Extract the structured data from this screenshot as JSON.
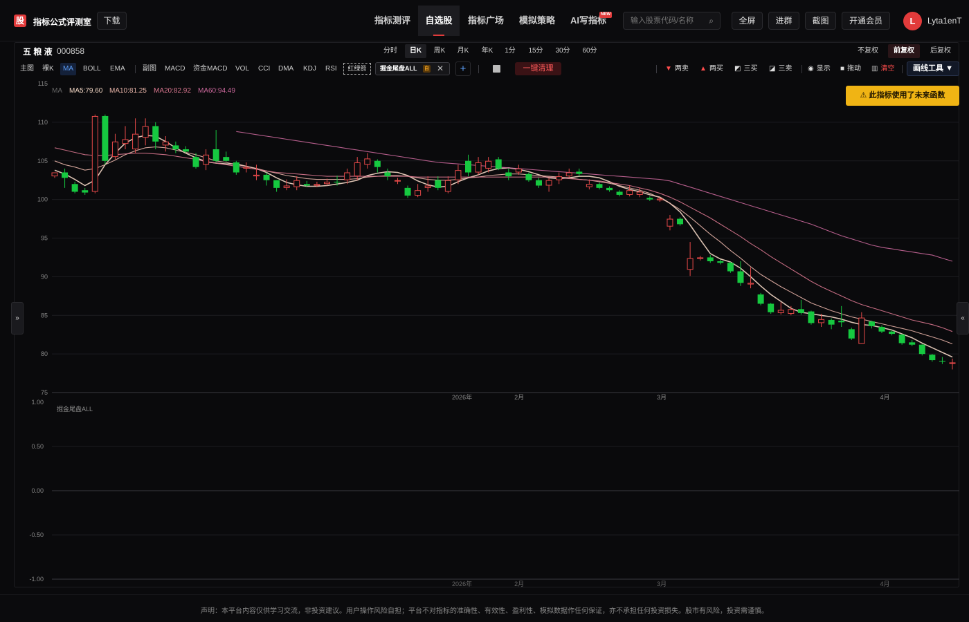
{
  "header": {
    "logo_char": "股",
    "brand": "指标公式评测室",
    "download": "下载",
    "nav": [
      {
        "label": "指标测评",
        "active": false
      },
      {
        "label": "自选股",
        "active": true
      },
      {
        "label": "指标广场",
        "active": false
      },
      {
        "label": "模拟策略",
        "active": false
      },
      {
        "label": "AI写指标",
        "active": false
      }
    ],
    "new_badge": "NEW",
    "search_placeholder": "输入股票代码/名称",
    "buttons": [
      "全屏",
      "进群",
      "截图",
      "开通会员"
    ],
    "avatar_initial": "L",
    "username": "Lyta1enT"
  },
  "stock": {
    "name": "五 粮 液",
    "code": "000858"
  },
  "periods": [
    {
      "label": "分时",
      "active": false
    },
    {
      "label": "日K",
      "active": true
    },
    {
      "label": "周K",
      "active": false
    },
    {
      "label": "月K",
      "active": false
    },
    {
      "label": "年K",
      "active": false
    },
    {
      "label": "1分",
      "active": false
    },
    {
      "label": "15分",
      "active": false
    },
    {
      "label": "30分",
      "active": false
    },
    {
      "label": "60分",
      "active": false
    }
  ],
  "adjust": [
    {
      "label": "不复权",
      "active": false
    },
    {
      "label": "前复权",
      "active": true
    },
    {
      "label": "后复权",
      "active": false
    }
  ],
  "indicators_main": [
    "主图",
    "裸K",
    "MA",
    "BOLL",
    "EMA"
  ],
  "indicators_sub": [
    "副图",
    "MACD",
    "资金MACD",
    "VOL",
    "CCI",
    "DMA",
    "KDJ",
    "RSI"
  ],
  "active_indicator": "MA",
  "dashed_indicator": "红绿箭",
  "custom_chip": {
    "label": "掘金尾盘ALL",
    "tag": "自"
  },
  "clear_button": "一键清理",
  "draw_tools": [
    {
      "label": "两卖",
      "icon": "down-triangle-icon",
      "color": "#ff4d4d"
    },
    {
      "label": "两买",
      "icon": "up-triangle-icon",
      "color": "#ff4d4d"
    },
    {
      "label": "三买",
      "icon": "three-buy-icon",
      "color": "#ddd"
    },
    {
      "label": "三卖",
      "icon": "three-sell-icon",
      "color": "#ddd"
    },
    {
      "label": "显示",
      "icon": "eye-icon",
      "color": "#ddd"
    },
    {
      "label": "拖动",
      "icon": "lock-icon",
      "color": "#ddd"
    },
    {
      "label": "清空",
      "icon": "trash-icon",
      "color": "#ff4d4d"
    }
  ],
  "draw_button": "画线工具 ▼",
  "warning": "此指标使用了未来函数",
  "ma_legend": [
    {
      "label": "MA",
      "color": "#666666"
    },
    {
      "label": "MA5:79.60",
      "color": "#f2d6c4"
    },
    {
      "label": "MA10:81.25",
      "color": "#e8b4a8"
    },
    {
      "label": "MA20:82.92",
      "color": "#d9778f"
    },
    {
      "label": "MA60:94.49",
      "color": "#c9679a"
    }
  ],
  "sub_chart_title": "掘金尾盘ALL",
  "x_axis_labels": [
    "2026年",
    "2月",
    "3月",
    "4月"
  ],
  "footer": "声明：本平台内容仅供学习交流，非投资建议。用户操作风险自担；平台不对指标的准确性、有效性、盈利性、模拟数据作任何保证，亦不承担任何投资损失。股市有风险，投资需谨慎。",
  "chart_data": [
    {
      "type": "candlestick",
      "title": "",
      "ylim": [
        75,
        115
      ],
      "y_ticks": [
        115,
        110,
        105,
        100,
        95,
        90,
        85,
        80,
        75
      ],
      "x_labels": [
        "2026年",
        "2月",
        "3月",
        "4月"
      ],
      "colors": {
        "up": "#e84a4a",
        "down": "#16c940"
      },
      "candles": [
        [
          103.0,
          103.5,
          102.8,
          103.2
        ],
        [
          103.5,
          102.8,
          101.5,
          104.0
        ],
        [
          102.0,
          101.0,
          100.8,
          102.3
        ],
        [
          101.2,
          100.9,
          100.6,
          101.5
        ],
        [
          101.0,
          110.8,
          100.8,
          111.0
        ],
        [
          110.8,
          105.0,
          104.5,
          111.0
        ],
        [
          105.5,
          107.5,
          105.2,
          108.5
        ],
        [
          107.2,
          107.8,
          106.5,
          109.5
        ],
        [
          106.5,
          108.5,
          106.0,
          110.5
        ],
        [
          108.0,
          109.5,
          107.0,
          110.5
        ],
        [
          109.5,
          107.5,
          106.5,
          110.0
        ],
        [
          107.0,
          107.5,
          106.2,
          108.2
        ],
        [
          107.0,
          106.5,
          106.0,
          107.5
        ],
        [
          106.5,
          106.2,
          106.0,
          106.9
        ],
        [
          105.5,
          104.2,
          104.0,
          106.0
        ],
        [
          104.5,
          105.8,
          103.8,
          106.5
        ],
        [
          106.5,
          105.0,
          104.8,
          109.0
        ],
        [
          105.5,
          105.0,
          104.9,
          106.2
        ],
        [
          104.8,
          103.5,
          103.2,
          105.0
        ],
        [
          104.0,
          104.2,
          103.5,
          104.8
        ],
        [
          103.0,
          103.2,
          102.5,
          104.5
        ],
        [
          103.2,
          102.5,
          101.8,
          103.5
        ],
        [
          102.5,
          101.5,
          101.0,
          102.5
        ],
        [
          101.5,
          101.8,
          101.2,
          102.6
        ],
        [
          101.6,
          102.5,
          101.2,
          103.0
        ],
        [
          102.0,
          101.8,
          101.6,
          102.4
        ],
        [
          101.8,
          102.0,
          101.6,
          102.3
        ],
        [
          102.0,
          102.3,
          101.8,
          102.7
        ],
        [
          102.3,
          102.2,
          101.8,
          103.1
        ],
        [
          102.5,
          103.5,
          102.0,
          104.0
        ],
        [
          103.0,
          104.8,
          102.5,
          105.5
        ],
        [
          104.5,
          105.3,
          104.0,
          106.0
        ],
        [
          105.0,
          104.2,
          103.5,
          105.2
        ],
        [
          103.5,
          103.0,
          102.5,
          104.0
        ],
        [
          102.5,
          102.5,
          102.0,
          102.8
        ],
        [
          101.5,
          100.5,
          100.2,
          101.8
        ],
        [
          100.5,
          101.2,
          100.3,
          102.0
        ],
        [
          101.5,
          101.8,
          101.0,
          103.0
        ],
        [
          102.5,
          101.5,
          101.2,
          103.0
        ],
        [
          101.0,
          102.5,
          100.8,
          103.0
        ],
        [
          102.5,
          103.8,
          102.0,
          104.5
        ],
        [
          105.0,
          103.5,
          103.0,
          105.8
        ],
        [
          103.5,
          104.8,
          103.2,
          105.5
        ],
        [
          104.0,
          105.0,
          103.5,
          105.5
        ],
        [
          105.2,
          104.0,
          103.8,
          105.5
        ],
        [
          103.5,
          103.0,
          102.5,
          104.0
        ],
        [
          103.5,
          104.0,
          103.2,
          104.5
        ],
        [
          103.3,
          102.5,
          102.3,
          103.5
        ],
        [
          102.5,
          101.8,
          101.5,
          102.8
        ],
        [
          101.8,
          102.5,
          101.0,
          102.8
        ],
        [
          102.5,
          103.0,
          102.0,
          103.5
        ],
        [
          103.0,
          103.5,
          102.8,
          104.0
        ],
        [
          103.6,
          103.3,
          103.0,
          104.0
        ],
        [
          101.6,
          102.0,
          101.3,
          102.6
        ],
        [
          102.0,
          101.5,
          101.3,
          102.2
        ],
        [
          101.5,
          101.2,
          101.0,
          101.7
        ],
        [
          101.0,
          100.6,
          100.4,
          101.2
        ],
        [
          100.6,
          101.2,
          100.4,
          101.8
        ],
        [
          100.6,
          101.0,
          100.3,
          101.5
        ],
        [
          100.2,
          100.0,
          99.8,
          100.4
        ],
        [
          99.9,
          100.1,
          99.7,
          100.3
        ],
        [
          96.5,
          97.5,
          96.0,
          98.0
        ],
        [
          97.5,
          96.8,
          96.6,
          97.7
        ],
        [
          90.9,
          92.4,
          90.1,
          94.5
        ],
        [
          92.3,
          92.5,
          92.1,
          92.7
        ],
        [
          92.5,
          92.0,
          91.8,
          92.8
        ],
        [
          92.0,
          91.8,
          91.6,
          92.2
        ],
        [
          91.8,
          90.7,
          90.5,
          91.9
        ],
        [
          90.7,
          89.2,
          88.8,
          92.0
        ],
        [
          89.0,
          89.2,
          88.5,
          91.2
        ],
        [
          87.7,
          86.5,
          86.3,
          87.9
        ],
        [
          86.5,
          85.4,
          85.2,
          86.6
        ],
        [
          85.3,
          85.7,
          85.1,
          86.7
        ],
        [
          85.2,
          85.8,
          85.0,
          86.2
        ],
        [
          85.8,
          85.3,
          85.1,
          87.0
        ],
        [
          85.5,
          84.0,
          83.8,
          85.6
        ],
        [
          84.0,
          84.5,
          83.5,
          85.2
        ],
        [
          84.4,
          83.8,
          83.2,
          84.6
        ],
        [
          84.3,
          84.1,
          83.5,
          86.2
        ],
        [
          83.2,
          82.0,
          81.8,
          83.4
        ],
        [
          81.3,
          84.7,
          81.3,
          85.4
        ],
        [
          84.2,
          83.6,
          83.3,
          84.3
        ],
        [
          83.5,
          82.9,
          82.7,
          83.7
        ],
        [
          82.9,
          82.6,
          82.4,
          83.1
        ],
        [
          82.5,
          81.4,
          81.2,
          82.6
        ],
        [
          81.5,
          81.2,
          81.0,
          81.8
        ],
        [
          81.2,
          80.0,
          79.8,
          81.3
        ],
        [
          79.9,
          79.2,
          79.0,
          80.0
        ],
        [
          79.1,
          79.0,
          78.7,
          79.6
        ],
        [
          78.9,
          78.9,
          78.0,
          79.4
        ]
      ],
      "ma_series": [
        {
          "name": "MA5",
          "color": "#f2d6c4",
          "start": 0,
          "values": [
            103.8,
            103.3,
            102.6,
            101.8,
            102.5,
            104.5,
            106.0,
            107.3,
            108.0,
            108.3,
            108.2,
            107.5,
            106.7,
            106.0,
            105.4,
            104.9,
            104.7,
            104.6,
            104.6,
            104.3,
            104.0,
            103.5,
            102.8,
            102.2,
            101.9,
            101.7,
            101.7,
            101.8,
            102.0,
            102.2,
            102.5,
            103.1,
            103.4,
            103.6,
            103.5,
            103.1,
            102.4,
            101.9,
            101.6,
            101.7,
            102.3,
            102.8,
            103.2,
            103.7,
            104.0,
            104.1,
            103.9,
            103.6,
            103.2,
            102.8,
            102.7,
            102.8,
            103.0,
            103.0,
            102.8,
            102.3,
            101.7,
            101.3,
            101.0,
            100.6,
            100.3,
            99.5,
            98.4,
            96.7,
            94.8,
            93.0,
            92.3,
            91.9,
            91.1,
            90.0,
            88.8,
            87.7,
            86.8,
            85.9,
            85.4,
            85.2,
            85.0,
            84.8,
            84.5,
            84.1,
            83.8,
            83.7,
            83.4,
            83.1,
            82.6,
            82.1,
            81.4,
            80.8,
            80.2,
            79.6
          ]
        },
        {
          "name": "MA10",
          "color": "#e8b4a8",
          "start": 0,
          "values": [
            105.0,
            104.5,
            104.2,
            103.8,
            104.0,
            104.5,
            105.1,
            105.8,
            106.3,
            106.7,
            106.8,
            106.7,
            106.4,
            106.1,
            105.8,
            105.4,
            105.0,
            104.8,
            104.5,
            104.3,
            104.0,
            103.7,
            103.4,
            103.1,
            102.9,
            102.7,
            102.6,
            102.6,
            102.6,
            102.6,
            102.7,
            102.9,
            103.0,
            103.1,
            103.1,
            103.0,
            102.8,
            102.6,
            102.5,
            102.5,
            102.6,
            102.8,
            102.9,
            103.1,
            103.2,
            103.3,
            103.3,
            103.2,
            103.1,
            103.0,
            102.9,
            102.8,
            102.6,
            102.5,
            102.3,
            102.1,
            101.8,
            101.5,
            101.2,
            100.8,
            100.2,
            99.5,
            98.7,
            97.7,
            96.6,
            95.5,
            94.5,
            93.4,
            92.4,
            91.3,
            90.3,
            89.5,
            88.7,
            88.0,
            87.3,
            86.6,
            86.1,
            85.6,
            85.2,
            84.8,
            84.5,
            84.2,
            83.9,
            83.6,
            83.3,
            83.0,
            82.6,
            82.2,
            81.8,
            81.3
          ]
        },
        {
          "name": "MA20",
          "color": "#d9778f",
          "start": 0,
          "values": [
            106.7,
            106.4,
            106.1,
            105.8,
            105.7,
            105.7,
            105.8,
            105.9,
            106.0,
            106.0,
            105.9,
            105.8,
            105.6,
            105.4,
            105.2,
            104.9,
            104.7,
            104.5,
            104.3,
            104.1,
            103.9,
            103.7,
            103.5,
            103.4,
            103.3,
            103.2,
            103.1,
            103.0,
            103.0,
            103.0,
            103.0,
            103.0,
            103.0,
            103.0,
            103.0,
            103.0,
            102.9,
            102.9,
            102.9,
            102.9,
            102.9,
            102.9,
            102.9,
            102.9,
            102.9,
            102.9,
            102.9,
            102.9,
            102.9,
            102.9,
            102.8,
            102.7,
            102.6,
            102.5,
            102.4,
            102.2,
            102.0,
            101.8,
            101.5,
            101.2,
            100.8,
            100.3,
            99.7,
            99.0,
            98.3,
            97.6,
            96.8,
            96.0,
            95.2,
            94.3,
            93.5,
            92.6,
            91.8,
            91.0,
            90.2,
            89.4,
            88.7,
            88.1,
            87.5,
            86.9,
            86.4,
            86.0,
            85.6,
            85.2,
            84.8,
            84.4,
            84.1,
            83.8,
            83.4,
            82.9
          ]
        },
        {
          "name": "MA60",
          "color": "#c9679a",
          "start": 18,
          "values": [
            108.8,
            108.6,
            108.4,
            108.2,
            108.0,
            107.8,
            107.6,
            107.4,
            107.2,
            107.0,
            106.8,
            106.6,
            106.4,
            106.2,
            106.0,
            105.8,
            105.6,
            105.4,
            105.2,
            105.0,
            104.8,
            104.7,
            104.6,
            104.5,
            104.4,
            104.3,
            104.2,
            104.1,
            104.0,
            103.9,
            103.8,
            103.7,
            103.6,
            103.5,
            103.4,
            103.3,
            103.2,
            103.1,
            103.0,
            102.9,
            102.8,
            102.7,
            102.6,
            102.4,
            102.0,
            101.6,
            101.2,
            100.8,
            100.4,
            100.0,
            99.6,
            99.2,
            98.8,
            98.4,
            98.0,
            97.6,
            97.2,
            96.8,
            96.3,
            95.8,
            95.3,
            94.9,
            94.5,
            94.1,
            93.8,
            93.6,
            93.4,
            93.2,
            93.0,
            92.8,
            92.4,
            92.0
          ]
        }
      ]
    },
    {
      "type": "line",
      "title": "掘金尾盘ALL",
      "ylim": [
        -1.0,
        1.0
      ],
      "y_ticks": [
        1.0,
        0.5,
        0.0,
        -0.5,
        -1.0
      ],
      "y_tick_labels": [
        "1.00",
        "0.50",
        "0.00",
        "-0.50",
        "-1.00"
      ],
      "x_labels": [
        "2026年",
        "2月",
        "3月",
        "4月"
      ],
      "series": []
    }
  ]
}
